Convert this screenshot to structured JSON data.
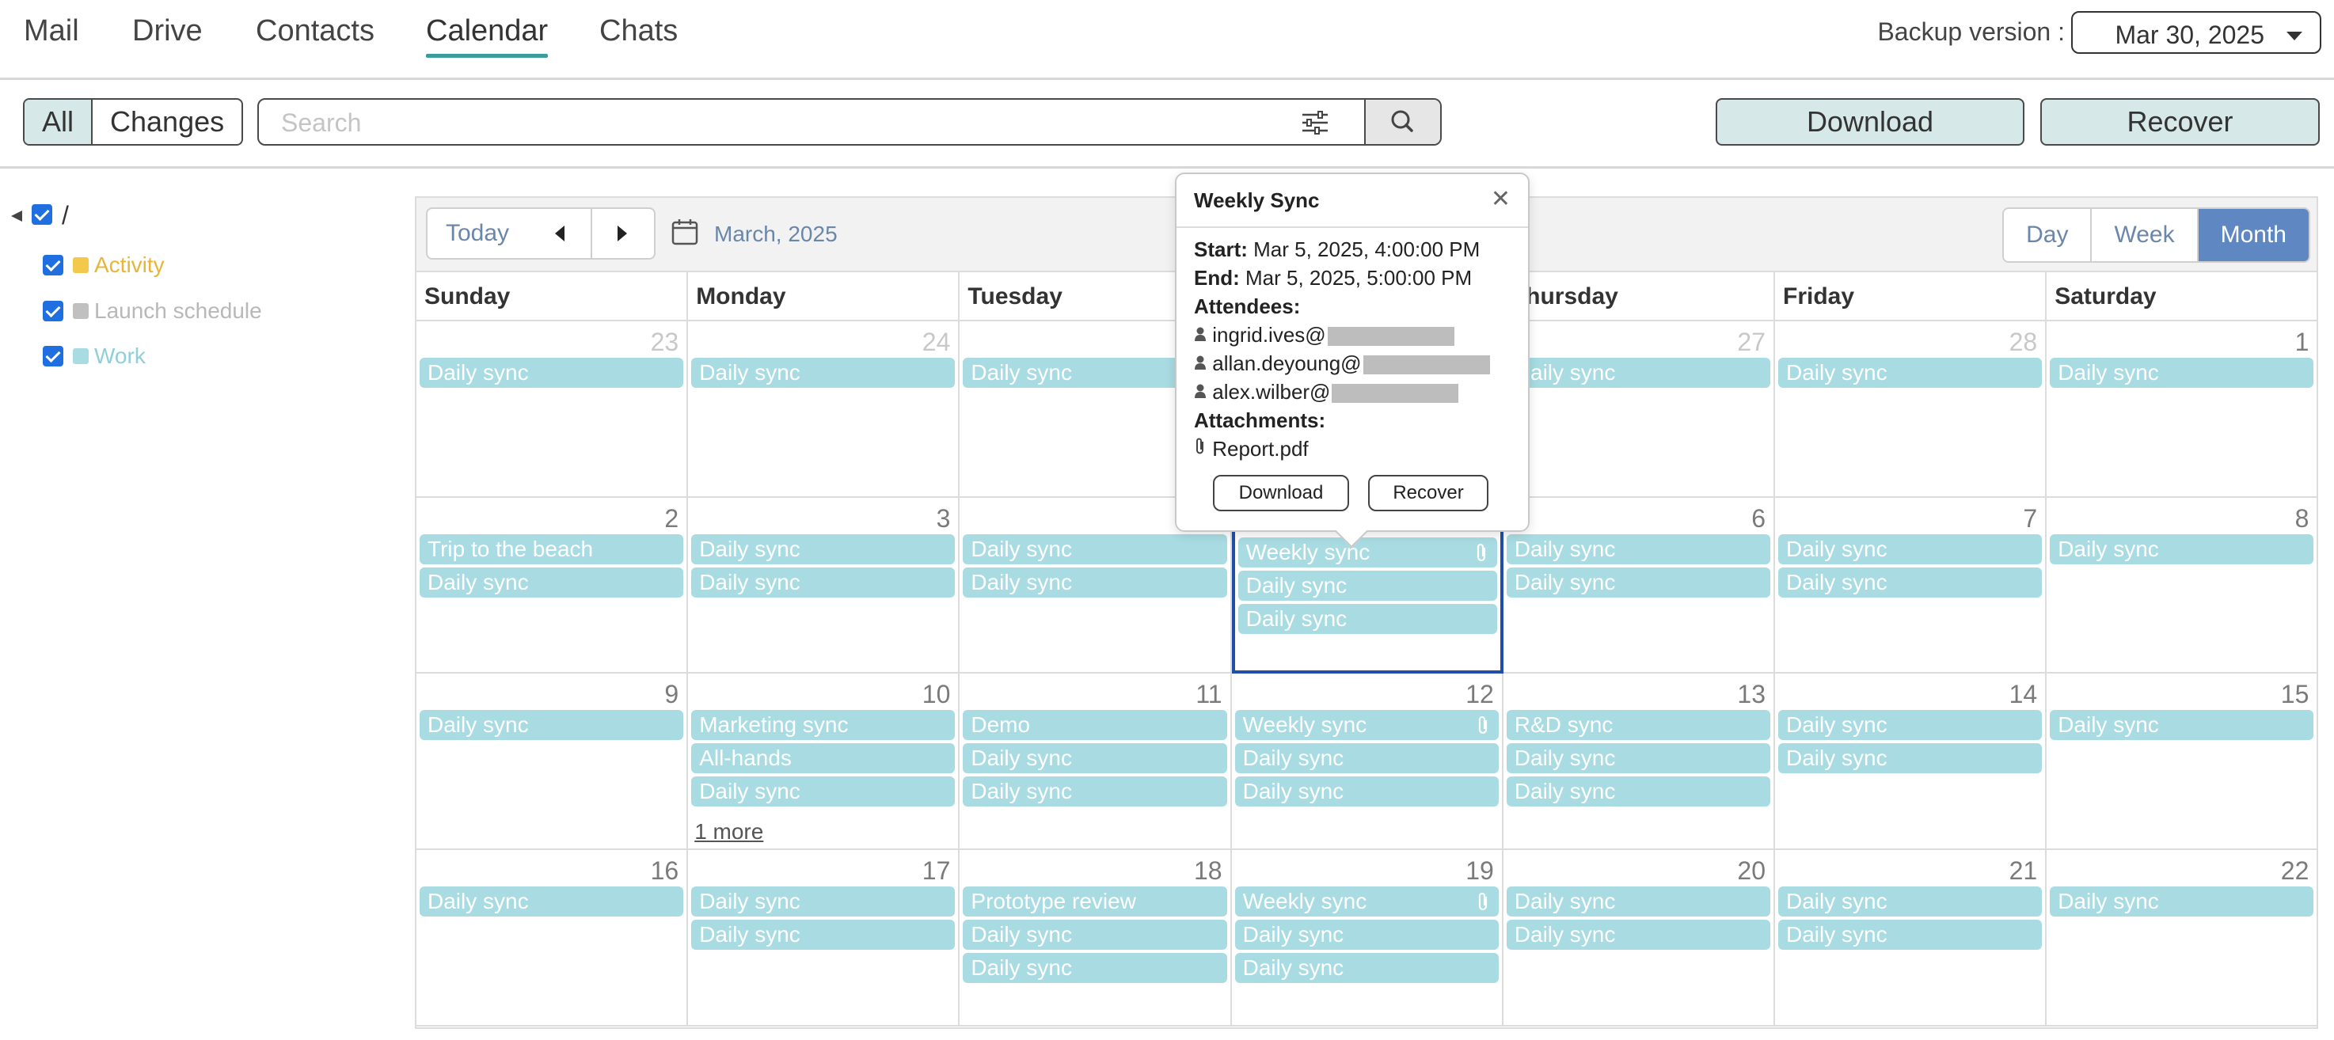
{
  "nav": {
    "tabs": [
      {
        "label": "Mail"
      },
      {
        "label": "Drive"
      },
      {
        "label": "Contacts"
      },
      {
        "label": "Calendar"
      },
      {
        "label": "Chats"
      }
    ],
    "active_tab": "Calendar",
    "backup_label": "Backup version :",
    "backup_value": "Mar 30, 2025"
  },
  "toolbar": {
    "all_label": "All",
    "changes_label": "Changes",
    "search_placeholder": "Search",
    "download_label": "Download",
    "recover_label": "Recover"
  },
  "tree": {
    "root_label": "/",
    "calendars": [
      {
        "label": "Activity",
        "color": "#f2c94c",
        "text_color": "#e8b53a"
      },
      {
        "label": "Launch schedule",
        "color": "#c0c0c0",
        "text_color": "#b8b8b8"
      },
      {
        "label": "Work",
        "color": "#a8dce2",
        "text_color": "#8fcfd8"
      }
    ]
  },
  "calendar": {
    "today_label": "Today",
    "month_label": "March, 2025",
    "views": [
      "Day",
      "Week",
      "Month"
    ],
    "active_view": "Month",
    "weekdays": [
      "Sunday",
      "Monday",
      "Tuesday",
      "Wednesday",
      "Thursday",
      "Friday",
      "Saturday"
    ],
    "weeks": [
      [
        {
          "day": "23",
          "other": true,
          "events": [
            "Daily sync"
          ]
        },
        {
          "day": "24",
          "other": true,
          "events": [
            "Daily sync"
          ]
        },
        {
          "day": "25",
          "other": true,
          "events": [
            "Daily sync"
          ]
        },
        {
          "day": "26",
          "other": true,
          "events": []
        },
        {
          "day": "27",
          "other": true,
          "events": [
            "Daily sync"
          ]
        },
        {
          "day": "28",
          "other": true,
          "events": [
            "Daily sync"
          ]
        },
        {
          "day": "1",
          "other": false,
          "events": [
            "Daily sync"
          ]
        }
      ],
      [
        {
          "day": "2",
          "other": false,
          "events": [
            "Trip to the beach",
            "Daily sync"
          ]
        },
        {
          "day": "3",
          "other": false,
          "events": [
            "Daily sync",
            "Daily sync"
          ]
        },
        {
          "day": "4",
          "other": false,
          "events": [
            "Daily sync",
            "Daily sync"
          ]
        },
        {
          "day": "5",
          "other": false,
          "selected": true,
          "events": [
            "Weekly sync",
            "Daily sync",
            "Daily sync"
          ],
          "attach": [
            0
          ]
        },
        {
          "day": "6",
          "other": false,
          "events": [
            "Daily sync",
            "Daily sync"
          ]
        },
        {
          "day": "7",
          "other": false,
          "events": [
            "Daily sync",
            "Daily sync"
          ]
        },
        {
          "day": "8",
          "other": false,
          "events": [
            "Daily sync"
          ]
        }
      ],
      [
        {
          "day": "9",
          "other": false,
          "events": [
            "Daily sync"
          ]
        },
        {
          "day": "10",
          "other": false,
          "events": [
            "Marketing sync",
            "All-hands",
            "Daily sync"
          ],
          "more": "1 more"
        },
        {
          "day": "11",
          "other": false,
          "events": [
            "Demo",
            "Daily sync",
            "Daily sync"
          ]
        },
        {
          "day": "12",
          "other": false,
          "events": [
            "Weekly sync",
            "Daily sync",
            "Daily sync"
          ],
          "attach": [
            0
          ]
        },
        {
          "day": "13",
          "other": false,
          "events": [
            "R&D sync",
            "Daily sync",
            "Daily sync"
          ]
        },
        {
          "day": "14",
          "other": false,
          "events": [
            "Daily sync",
            "Daily sync"
          ]
        },
        {
          "day": "15",
          "other": false,
          "events": [
            "Daily sync"
          ]
        }
      ],
      [
        {
          "day": "16",
          "other": false,
          "events": [
            "Daily sync"
          ]
        },
        {
          "day": "17",
          "other": false,
          "events": [
            "Daily sync",
            "Daily sync"
          ]
        },
        {
          "day": "18",
          "other": false,
          "events": [
            "Prototype review",
            "Daily sync",
            "Daily sync"
          ]
        },
        {
          "day": "19",
          "other": false,
          "events": [
            "Weekly sync",
            "Daily sync",
            "Daily sync"
          ],
          "attach": [
            0
          ]
        },
        {
          "day": "20",
          "other": false,
          "events": [
            "Daily sync",
            "Daily sync"
          ]
        },
        {
          "day": "21",
          "other": false,
          "events": [
            "Daily sync",
            "Daily sync"
          ]
        },
        {
          "day": "22",
          "other": false,
          "events": [
            "Daily sync"
          ]
        }
      ]
    ]
  },
  "popover": {
    "title": "Weekly Sync",
    "start_label": "Start:",
    "start_value": "Mar 5, 2025, 4:00:00 PM",
    "end_label": "End:",
    "end_value": "Mar 5, 2025, 5:00:00 PM",
    "attendees_label": "Attendees:",
    "attendees": [
      "ingrid.ives@",
      "allan.deyoung@",
      "alex.wilber@"
    ],
    "attachments_label": "Attachments:",
    "attachment": "Report.pdf",
    "download_label": "Download",
    "recover_label": "Recover"
  },
  "colors": {
    "event": "#a8dce2",
    "accent": "#3a9c9c",
    "selected_border": "#1f4fa8",
    "active_view": "#5f87c2"
  }
}
